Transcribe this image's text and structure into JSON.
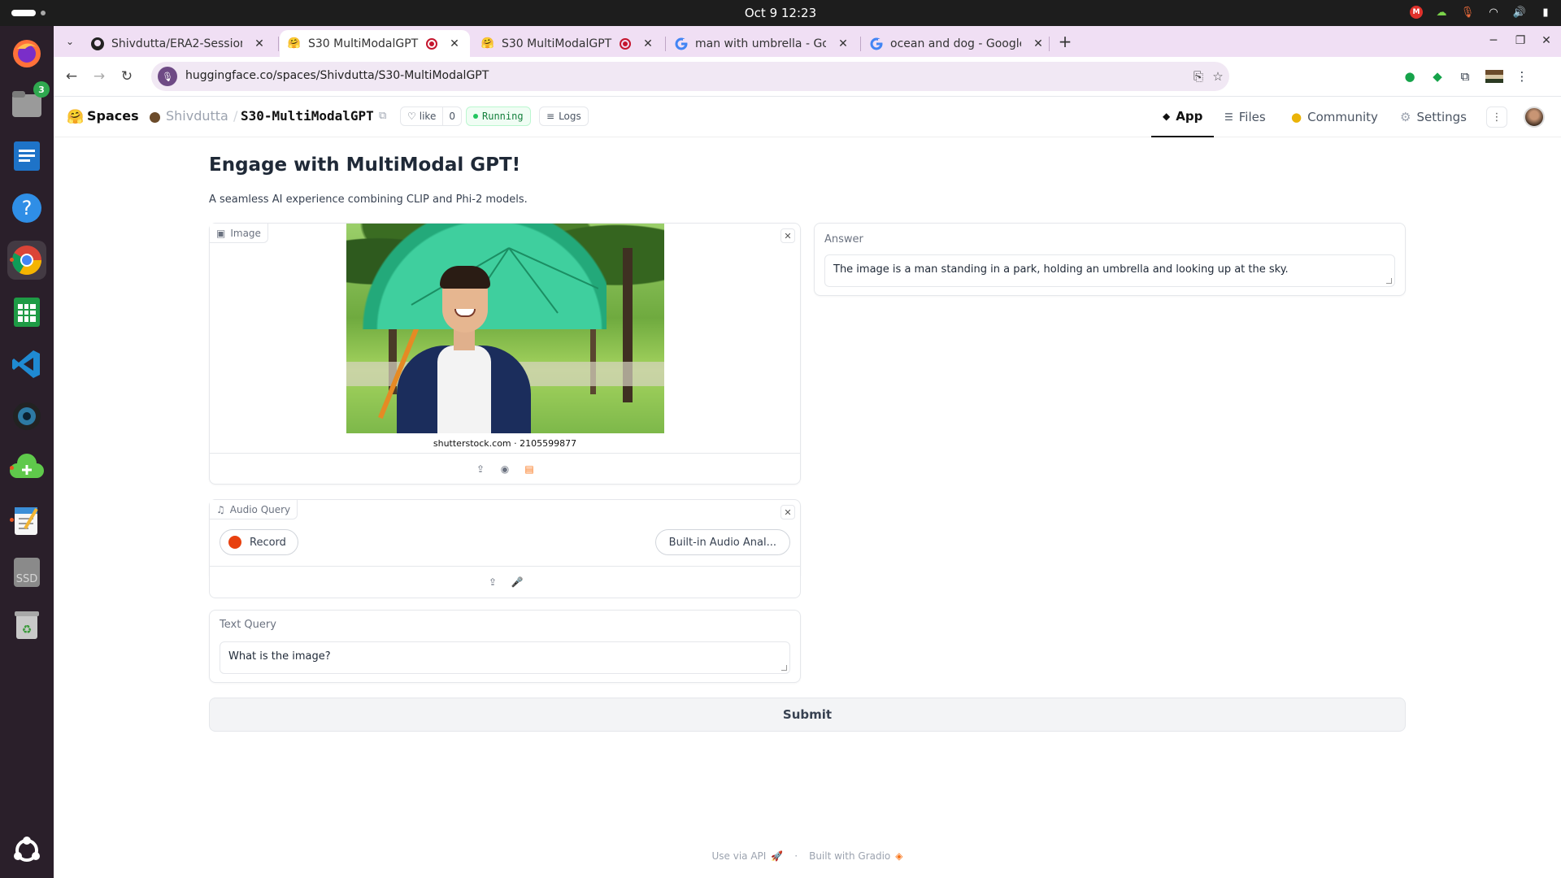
{
  "system": {
    "clock": "Oct 9  12:23",
    "dock_badge": "3",
    "ssd_label": "SSD"
  },
  "browser": {
    "tabs": [
      {
        "title": "Shivdutta/ERA2-Session-",
        "active": false
      },
      {
        "title": "S30 MultiModalGPT -",
        "active": true
      },
      {
        "title": "S30 MultiModalGPT -",
        "active": false
      },
      {
        "title": "man with umbrella - Goo",
        "active": false
      },
      {
        "title": "ocean and dog - Google S",
        "active": false
      }
    ],
    "url": "huggingface.co/spaces/Shivdutta/S30-MultiModalGPT"
  },
  "hf": {
    "spaces_label": "Spaces",
    "owner": "Shivdutta",
    "repo": "S30-MultiModalGPT",
    "like_label": "like",
    "like_count": "0",
    "status": "Running",
    "logs_label": "Logs",
    "nav": [
      {
        "label": "App",
        "icon": "cube-icon"
      },
      {
        "label": "Files",
        "icon": "files-icon"
      },
      {
        "label": "Community",
        "icon": "community-icon"
      },
      {
        "label": "Settings",
        "icon": "gear-icon"
      }
    ]
  },
  "app": {
    "title": "Engage with MultiModal GPT!",
    "description": "A seamless AI experience combining CLIP and Phi-2 models.",
    "image_label": "Image",
    "image_credit": "shutterstock.com · 2105599877",
    "audio_label": "Audio Query",
    "record_label": "Record",
    "audio_device": "Built-in Audio Anal...",
    "text_query_label": "Text Query",
    "text_query_value": "What is the image?",
    "answer_label": "Answer",
    "answer_value": "The image is a man standing in a park, holding an umbrella and looking up at the sky.",
    "submit_label": "Submit",
    "footer_api": "Use via API",
    "footer_built": "Built with Gradio"
  }
}
